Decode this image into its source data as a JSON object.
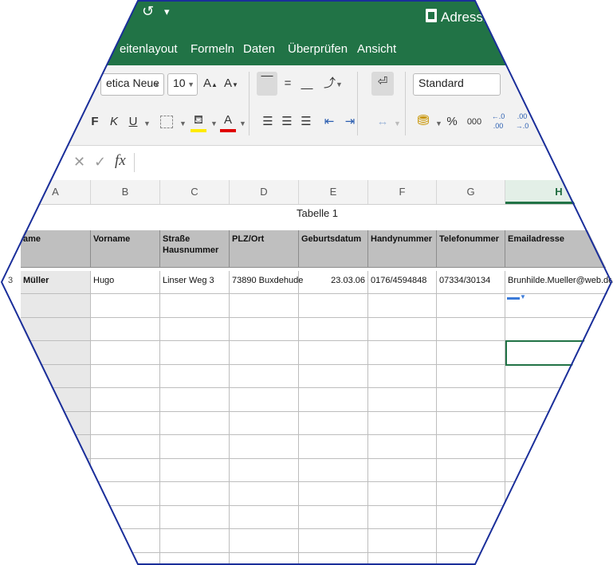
{
  "window": {
    "title": "Adressliste"
  },
  "ribbon_tabs": [
    "eitenlayout",
    "Formeln",
    "Daten",
    "Überprüfen",
    "Ansicht"
  ],
  "toolbar": {
    "font_name": "etica Neue",
    "font_size": "10",
    "bold_label": "F",
    "italic_label": "K",
    "underline_label": "U",
    "number_format": "Standard",
    "percent_label": "%",
    "thousands_label": "000"
  },
  "formula_bar": {
    "fx_label": "fx",
    "value": ""
  },
  "columns": [
    "A",
    "B",
    "C",
    "D",
    "E",
    "F",
    "G",
    "H"
  ],
  "active_column": "H",
  "sheet": {
    "caption": "Tabelle 1",
    "row_number": "3",
    "headers": [
      "ame",
      "Vorname",
      "Straße Hausnummer",
      "PLZ/Ort",
      "Geburtsdatum",
      "Handynummer",
      "Telefonummer",
      "Emailadresse"
    ],
    "rows": [
      [
        "Müller",
        "Hugo",
        "Linser Weg 3",
        "73890 Buxdehude",
        "23.03.06",
        "0176/4594848",
        "07334/30134",
        "Brunhilde.Mueller@web.de"
      ]
    ]
  },
  "colors": {
    "accent": "#217346",
    "header_fill": "#bfbfbf",
    "hexagon_outline": "#1a2e9a"
  }
}
